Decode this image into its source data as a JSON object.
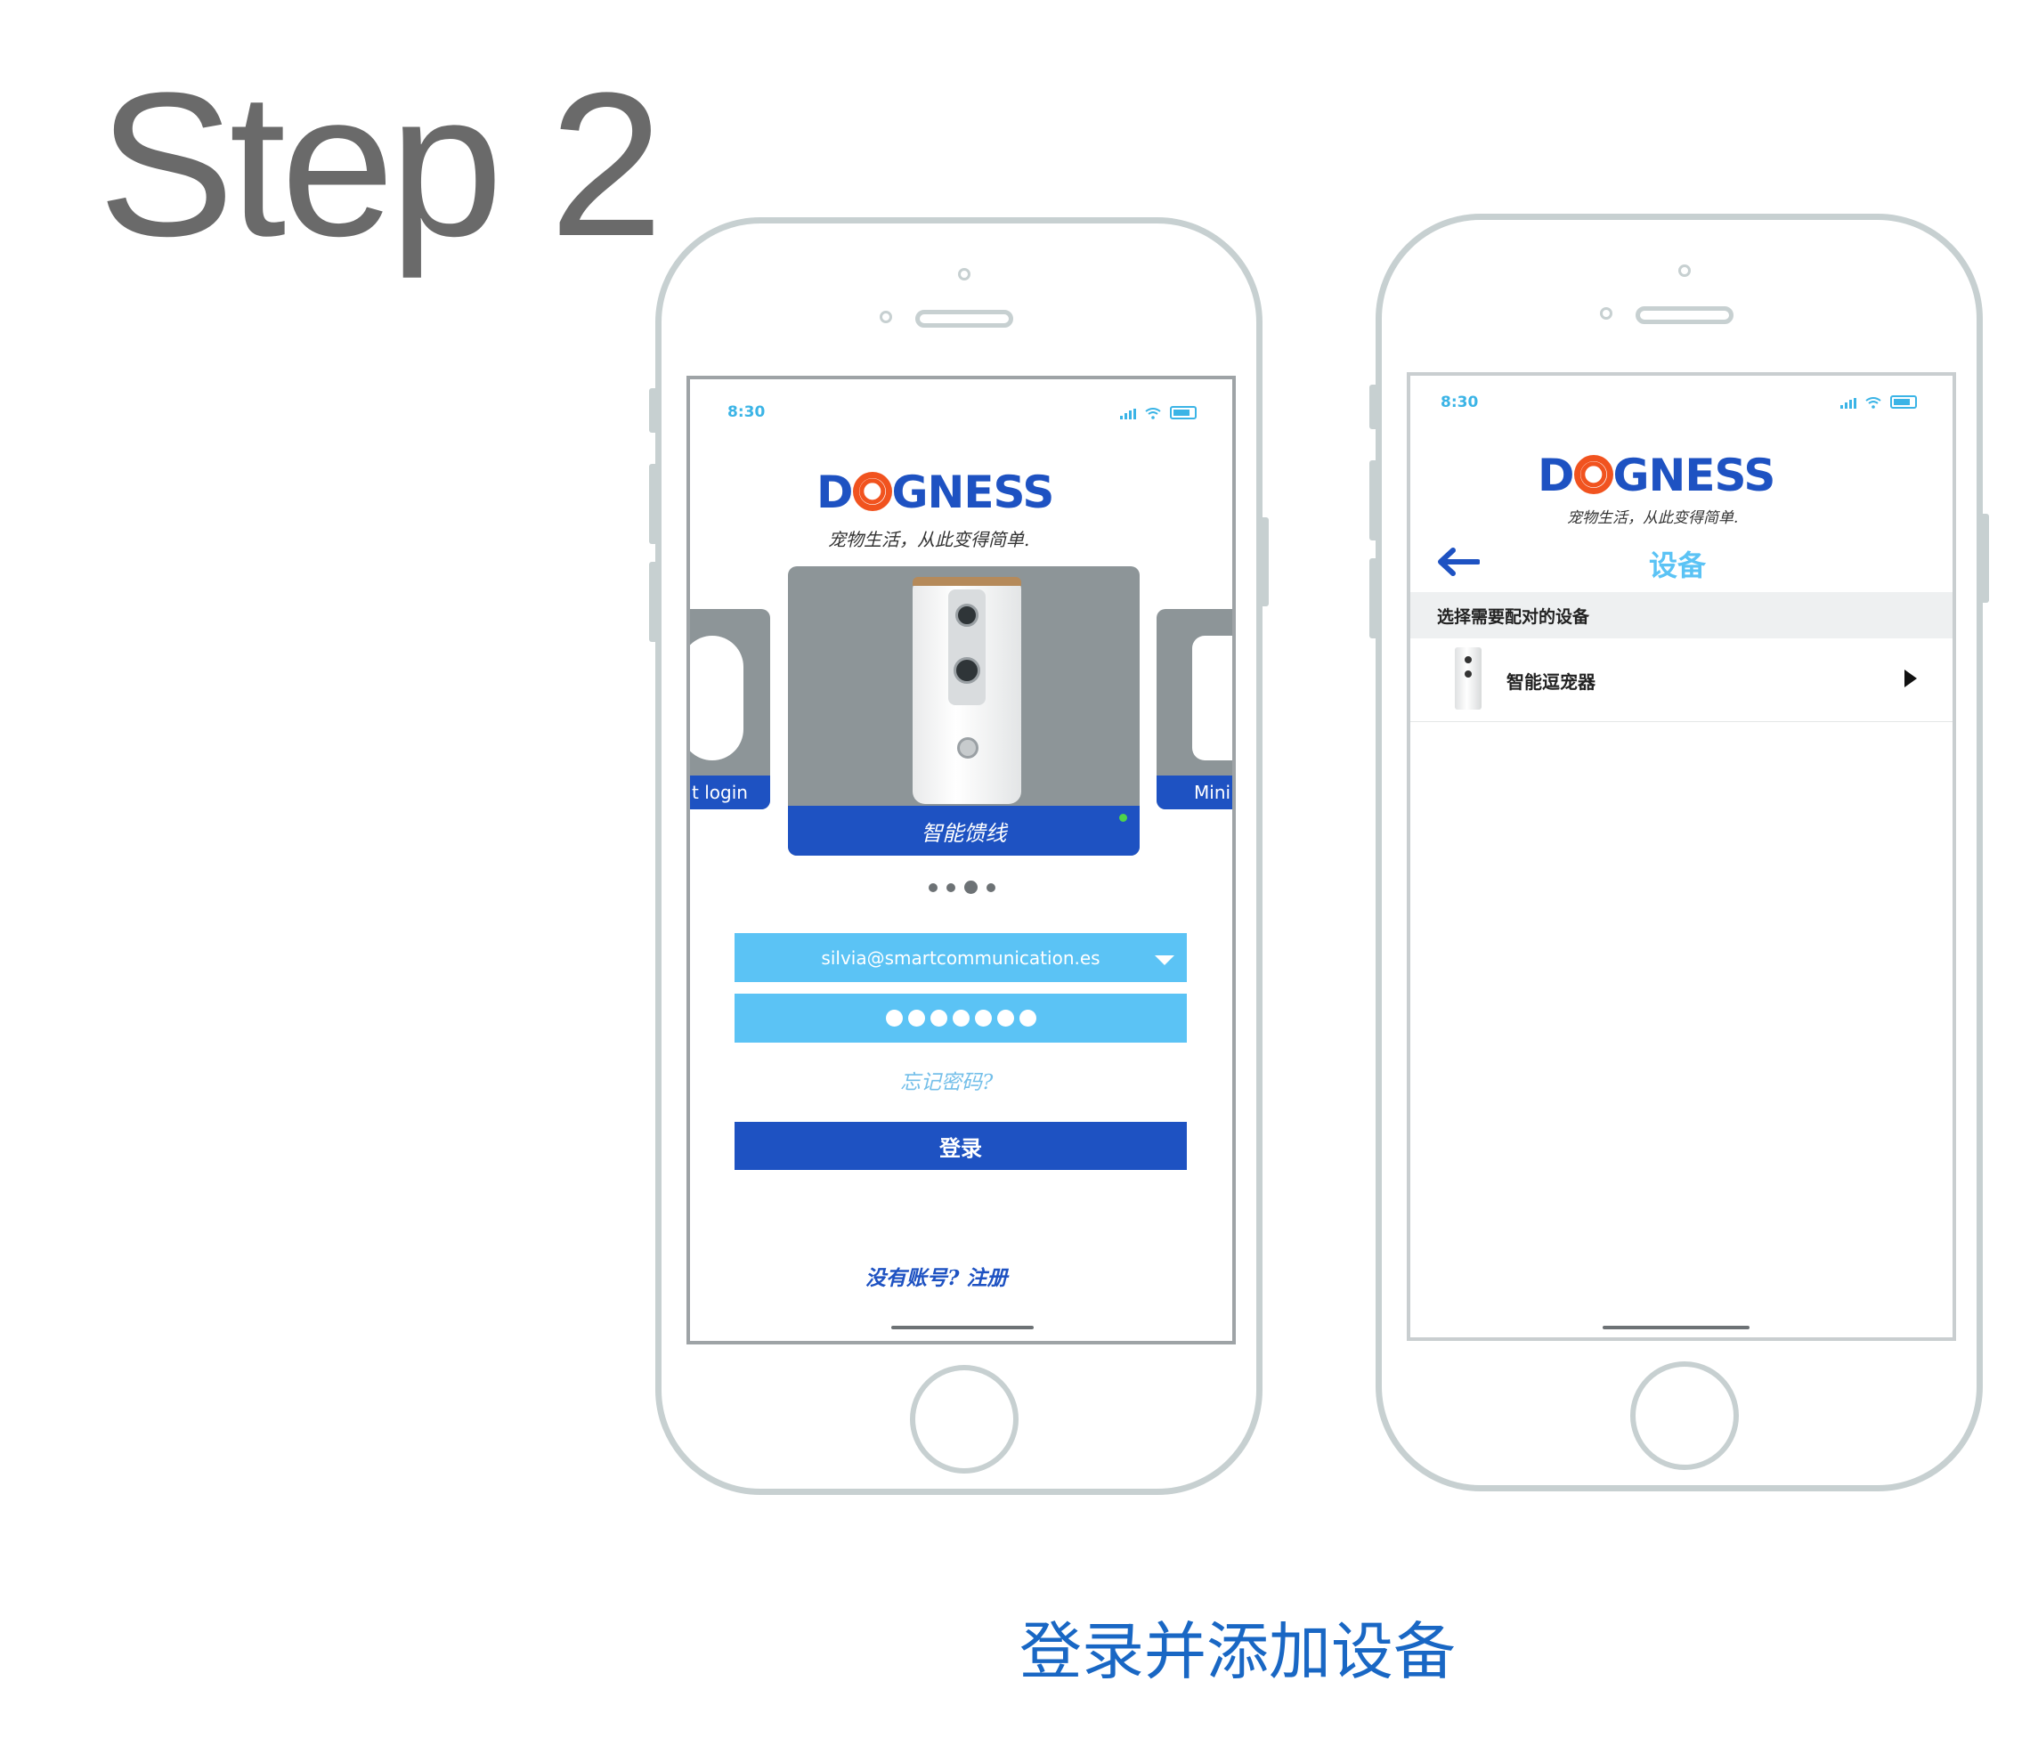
{
  "page": {
    "step_title": "Step 2",
    "caption": "登录并添加设备"
  },
  "login_screen": {
    "status_time": "8:30",
    "logo": {
      "part1": "D",
      "part2": "GNESS"
    },
    "slogan": "宠物生活，从此变得简单.",
    "carousel": {
      "left_label": "t login",
      "center_label": "智能馈线",
      "right_label": "Mini",
      "page_count": 4,
      "active_index": 2
    },
    "email_value": "silvia@smartcommunication.es",
    "password_length": 7,
    "forgot_password": "忘记密码?",
    "login_button": "登录",
    "register_prompt": "没有账号? 注册"
  },
  "device_screen": {
    "status_time": "8:30",
    "logo": {
      "part1": "D",
      "part2": "GNESS"
    },
    "slogan": "宠物生活，从此变得简单.",
    "title": "设备",
    "section_header": "选择需要配对的设备",
    "devices": [
      {
        "name": "智能逗宠器"
      }
    ]
  },
  "colors": {
    "brand_blue": "#1e52c2",
    "light_blue": "#5bc3f5",
    "logo_orange": "#f1531f",
    "frame_gray": "#c7d0d1",
    "caption_blue": "#1967c4"
  }
}
